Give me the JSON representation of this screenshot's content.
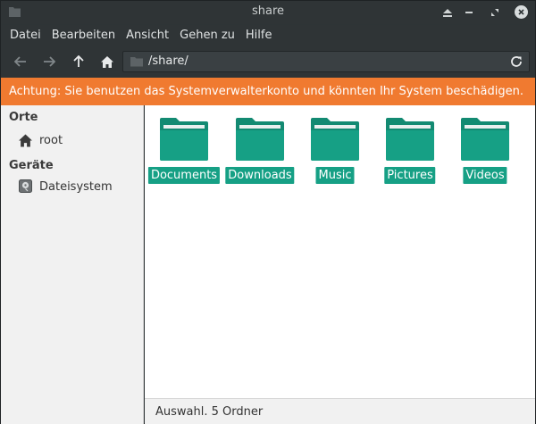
{
  "window": {
    "title": "share"
  },
  "menu": [
    "Datei",
    "Bearbeiten",
    "Ansicht",
    "Gehen zu",
    "Hilfe"
  ],
  "toolbar": {
    "back_icon": "arrow-left-icon",
    "forward_icon": "arrow-right-icon",
    "up_icon": "arrow-up-icon",
    "home_icon": "home-icon",
    "location": "/share/",
    "reload_icon": "reload-icon"
  },
  "warning": "Achtung: Sie benutzen das Systemverwalterkonto und könnten Ihr System beschädigen.",
  "sidebar": {
    "places_header": "Orte",
    "places": [
      {
        "label": "root",
        "icon": "home-icon"
      }
    ],
    "devices_header": "Geräte",
    "devices": [
      {
        "label": "Dateisystem",
        "icon": "drive-icon"
      }
    ]
  },
  "folders": [
    {
      "label": "Documents"
    },
    {
      "label": "Downloads"
    },
    {
      "label": "Music"
    },
    {
      "label": "Pictures"
    },
    {
      "label": "Videos"
    }
  ],
  "status": "Auswahl. 5 Ordner",
  "colors": {
    "accent": "#16a085",
    "warning": "#f07a30",
    "chrome": "#2f3436"
  }
}
